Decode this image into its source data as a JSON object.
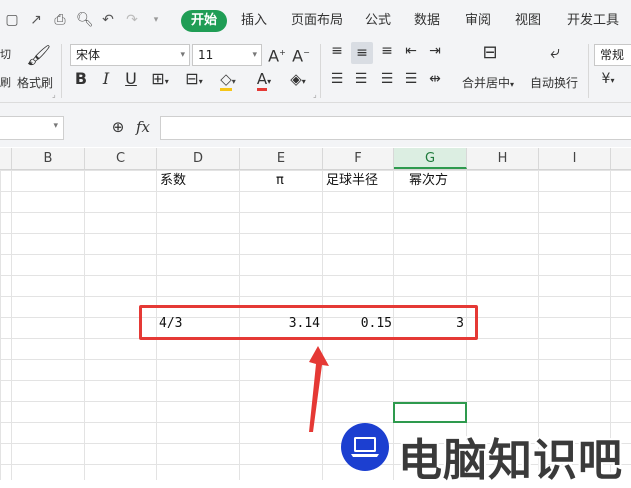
{
  "tabs": {
    "items": [
      "开始",
      "插入",
      "页面布局",
      "公式",
      "数据",
      "审阅",
      "视图",
      "开发工具"
    ],
    "active": "开始"
  },
  "ribbon": {
    "cut_label": "切",
    "paste_label": "刷",
    "format_painter_label": "格式刷",
    "font_name": "宋体",
    "font_size": "11",
    "merge_center_label": "合并居中",
    "wrap_text_label": "自动换行",
    "number_format": "常规",
    "currency_symbol": "¥"
  },
  "formula_bar": {
    "fx_label": "fx",
    "formula_value": ""
  },
  "columns": [
    "B",
    "C",
    "D",
    "E",
    "F",
    "G",
    "H",
    "I"
  ],
  "selected_column": "G",
  "sheet": {
    "headers": {
      "D": "系数",
      "E": "π",
      "F": "足球半径",
      "G": "幂次方"
    },
    "values": {
      "D": "4/3",
      "E": "3.14",
      "F": "0.15",
      "G": "3"
    }
  },
  "watermark": {
    "text": "电脑知识吧"
  },
  "colors": {
    "accent_green": "#1f9d55",
    "annotation_red": "#e53935",
    "watermark_blue": "#1c3fd0"
  }
}
